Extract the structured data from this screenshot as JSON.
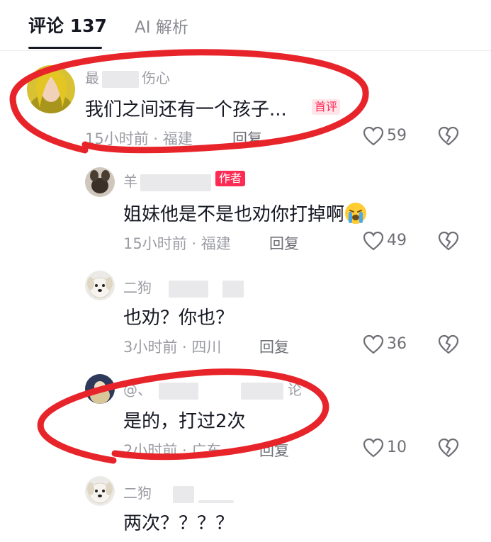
{
  "tabs": {
    "comments_label": "评论 137",
    "ai_label": "AI 解析"
  },
  "comments": [
    {
      "name": "最",
      "name_suffix": "伤心",
      "text": "我们之间还有一个孩子...",
      "badge": "首评",
      "time": "15小时前 · 福建",
      "reply": "回复",
      "likes": "59"
    },
    {
      "name": "羊",
      "name_suffix": "",
      "badge": "作者",
      "text": "姐妹他是不是也劝你打掉啊",
      "emoji": "crying-face",
      "time": "15小时前 · 福建",
      "reply": "回复",
      "likes": "49"
    },
    {
      "name": "二狗",
      "text": "也劝？你也？",
      "time": "3小时前 · 四川",
      "reply": "回复",
      "likes": "36"
    },
    {
      "name": "@、",
      "name_suffix": "论",
      "text": "是的，打过2次",
      "time": "2小时前 · 广东",
      "reply": "回复",
      "likes": "10"
    },
    {
      "name": "二狗",
      "text": "两次？？？？"
    }
  ],
  "colors": {
    "accent": "#fe2c55",
    "annotation": "#e8242b",
    "text": "#161823",
    "muted": "#9b9ca3"
  }
}
